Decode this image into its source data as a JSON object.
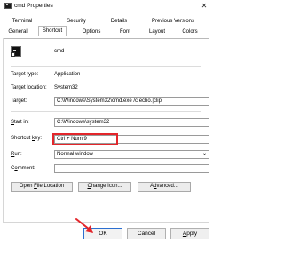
{
  "window": {
    "title": "cmd Properties",
    "close_glyph": "✕"
  },
  "tabs": {
    "row1": [
      "Terminal",
      "Security",
      "Details",
      "Previous Versions"
    ],
    "row2": [
      "General",
      "Shortcut",
      "Options",
      "Font",
      "Layout",
      "Colors"
    ],
    "active": "Shortcut"
  },
  "app": {
    "name": "cmd"
  },
  "info": {
    "target_type_label": "Target type:",
    "target_type_value": "Application",
    "target_location_label": "Target location:",
    "target_location_value": "System32"
  },
  "fields": {
    "target_label": "Target:",
    "target_value": "C:\\Windows\\System32\\cmd.exe /c echo.|clip",
    "start_in_label_pre": "",
    "start_in_label_u": "S",
    "start_in_label_post": "tart in:",
    "start_in_value": "C:\\Windows\\system32",
    "shortcut_key_label_pre": "Shortcut ",
    "shortcut_key_label_u": "k",
    "shortcut_key_label_post": "ey:",
    "shortcut_key_value": "Ctrl + Num 9",
    "run_label_u": "R",
    "run_label_post": "un:",
    "run_value": "Normal window",
    "comment_label_pre": "C",
    "comment_label_u": "o",
    "comment_label_post": "mment:",
    "comment_value": ""
  },
  "buttons": {
    "open_file_location_pre": "Open ",
    "open_file_location_u": "F",
    "open_file_location_post": "ile Location",
    "change_icon_pre": "",
    "change_icon_u": "C",
    "change_icon_post": "hange Icon...",
    "advanced_pre": "A",
    "advanced_u": "d",
    "advanced_post": "vanced...",
    "ok": "OK",
    "cancel": "Cancel",
    "apply_u": "A",
    "apply_post": "pply"
  },
  "colors": {
    "highlight": "#e3262b",
    "arrow": "#e3262b"
  }
}
